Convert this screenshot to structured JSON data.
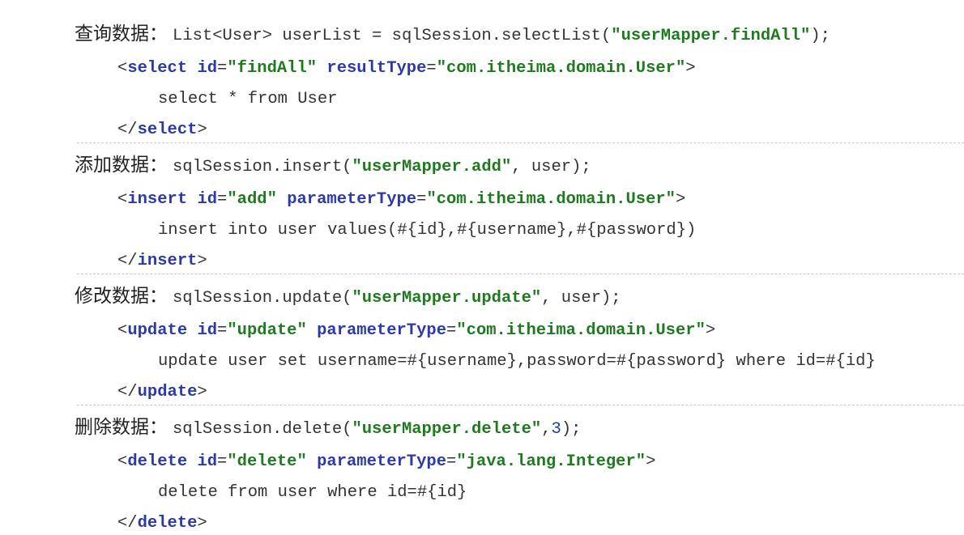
{
  "sections": [
    {
      "title": "查询数据：",
      "lines": [
        [
          [
            "p",
            "List<User> userList = sqlSession.selectList("
          ],
          [
            "s",
            "\"userMapper.findAll\""
          ],
          [
            "p",
            ");"
          ]
        ],
        [
          [
            "p",
            "<"
          ],
          [
            "k",
            "select"
          ],
          [
            "p",
            " "
          ],
          [
            "k",
            "id"
          ],
          [
            "p",
            "="
          ],
          [
            "s",
            "\"findAll\""
          ],
          [
            "p",
            " "
          ],
          [
            "k",
            "resultType"
          ],
          [
            "p",
            "="
          ],
          [
            "s",
            "\"com.itheima.domain.User\""
          ],
          [
            "p",
            ">"
          ]
        ],
        [
          [
            "p",
            "select * from User"
          ]
        ],
        [
          [
            "p",
            "</"
          ],
          [
            "k",
            "select"
          ],
          [
            "p",
            ">"
          ]
        ]
      ]
    },
    {
      "title": "添加数据：",
      "lines": [
        [
          [
            "p",
            "sqlSession.insert("
          ],
          [
            "s",
            "\"userMapper.add\""
          ],
          [
            "p",
            ", user);"
          ]
        ],
        [
          [
            "p",
            "<"
          ],
          [
            "k",
            "insert"
          ],
          [
            "p",
            " "
          ],
          [
            "k",
            "id"
          ],
          [
            "p",
            "="
          ],
          [
            "s",
            "\"add\""
          ],
          [
            "p",
            " "
          ],
          [
            "k",
            "parameterType"
          ],
          [
            "p",
            "="
          ],
          [
            "s",
            "\"com.itheima.domain.User\""
          ],
          [
            "p",
            ">"
          ]
        ],
        [
          [
            "p",
            "insert into user values(#{id},#{username},#{password})"
          ]
        ],
        [
          [
            "p",
            "</"
          ],
          [
            "k",
            "insert"
          ],
          [
            "p",
            ">"
          ]
        ]
      ]
    },
    {
      "title": "修改数据：",
      "lines": [
        [
          [
            "p",
            "sqlSession.update("
          ],
          [
            "s",
            "\"userMapper.update\""
          ],
          [
            "p",
            ", user);"
          ]
        ],
        [
          [
            "p",
            "<"
          ],
          [
            "k",
            "update"
          ],
          [
            "p",
            " "
          ],
          [
            "k",
            "id"
          ],
          [
            "p",
            "="
          ],
          [
            "s",
            "\"update\""
          ],
          [
            "p",
            " "
          ],
          [
            "k",
            "parameterType"
          ],
          [
            "p",
            "="
          ],
          [
            "s",
            "\"com.itheima.domain.User\""
          ],
          [
            "p",
            ">"
          ]
        ],
        [
          [
            "p",
            "update user set username=#{username},password=#{password} where id=#{id}"
          ]
        ],
        [
          [
            "p",
            "</"
          ],
          [
            "k",
            "update"
          ],
          [
            "p",
            ">"
          ]
        ]
      ]
    },
    {
      "title": "删除数据：",
      "lines": [
        [
          [
            "p",
            "sqlSession.delete("
          ],
          [
            "s",
            "\"userMapper.delete\""
          ],
          [
            "p",
            ","
          ],
          [
            "n",
            "3"
          ],
          [
            "p",
            ");"
          ]
        ],
        [
          [
            "p",
            "<"
          ],
          [
            "k",
            "delete"
          ],
          [
            "p",
            " "
          ],
          [
            "k",
            "id"
          ],
          [
            "p",
            "="
          ],
          [
            "s",
            "\"delete\""
          ],
          [
            "p",
            " "
          ],
          [
            "k",
            "parameterType"
          ],
          [
            "p",
            "="
          ],
          [
            "s",
            "\"java.lang.Integer\""
          ],
          [
            "p",
            ">"
          ]
        ],
        [
          [
            "p",
            "delete from user where id=#{id}"
          ]
        ],
        [
          [
            "p",
            "</"
          ],
          [
            "k",
            "delete"
          ],
          [
            "p",
            ">"
          ]
        ]
      ]
    }
  ],
  "colors": {
    "plain": "#333333",
    "keyword": "#2c3aa8",
    "string": "#1f7a1f",
    "number": "#2c3aa8",
    "divider": "#c8c8c8"
  }
}
